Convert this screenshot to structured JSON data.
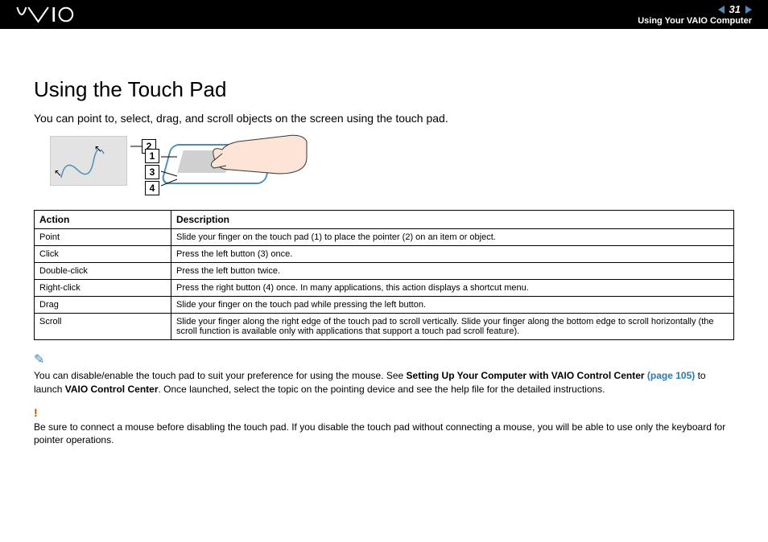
{
  "header": {
    "page_number": "31",
    "section": "Using Your VAIO Computer"
  },
  "title": "Using the Touch Pad",
  "intro": "You can point to, select, drag, and scroll objects on the screen using the touch pad.",
  "callouts": {
    "c1": "1",
    "c2": "2",
    "c3": "3",
    "c4": "4"
  },
  "table": {
    "headers": {
      "action": "Action",
      "description": "Description"
    },
    "rows": [
      {
        "action": "Point",
        "description": "Slide your finger on the touch pad (1) to place the pointer (2) on an item or object."
      },
      {
        "action": "Click",
        "description": "Press the left button (3) once."
      },
      {
        "action": "Double-click",
        "description": "Press the left button twice."
      },
      {
        "action": "Right-click",
        "description": "Press the right button (4) once. In many applications, this action displays a shortcut menu."
      },
      {
        "action": "Drag",
        "description": "Slide your finger on the touch pad while pressing the left button."
      },
      {
        "action": "Scroll",
        "description": "Slide your finger along the right edge of the touch pad to scroll vertically. Slide your finger along the bottom edge to scroll horizontally (the scroll function is available only with applications that support a touch pad scroll feature)."
      }
    ]
  },
  "note": {
    "pre": "You can disable/enable the touch pad to suit your preference for using the mouse. See ",
    "link_bold": "Setting Up Your Computer with VAIO Control Center ",
    "link_page": "(page 105)",
    "mid": " to launch ",
    "bold2": "VAIO Control Center",
    "post": ". Once launched, select the topic on the pointing device and see the help file for the detailed instructions."
  },
  "warning": {
    "icon": "!",
    "text": "Be sure to connect a mouse before disabling the touch pad. If you disable the touch pad without connecting a mouse, you will be able to use only the keyboard for pointer operations."
  }
}
